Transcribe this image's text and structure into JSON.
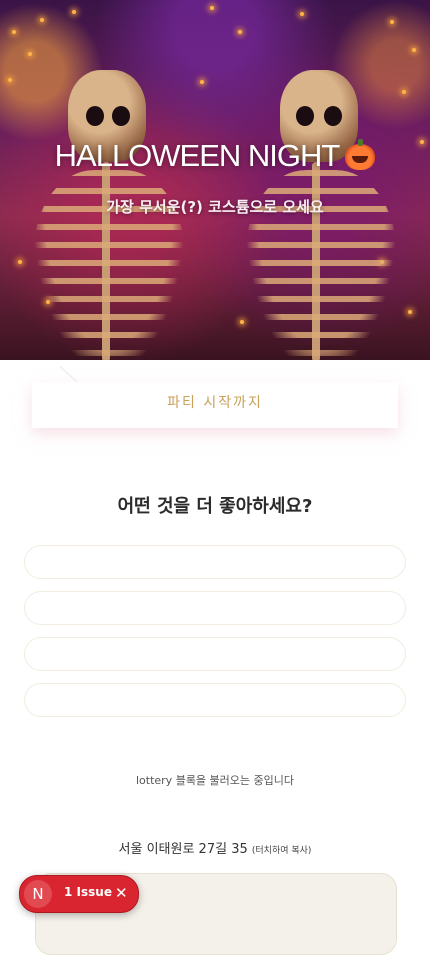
{
  "hero": {
    "title": "HALLOWEEN NIGHT",
    "title_emoji_icon": "pumpkin-icon",
    "subtitle": "가장 무서운(?) 코스튬으로 오세요"
  },
  "countdown": {
    "label": "파티 시작까지"
  },
  "poll": {
    "question": "어떤 것을 더 좋아하세요?",
    "options": [
      "",
      "",
      "",
      ""
    ]
  },
  "lottery": {
    "loading_text": "lottery 블록을 불러오는 중입니다"
  },
  "location": {
    "address": "서울 이태원로 27길 35",
    "copy_hint": "(터치하여 복사)"
  },
  "issue_badge": {
    "initial": "N",
    "label": "1 Issue",
    "close_glyph": "✕",
    "color": "#d9252f"
  }
}
